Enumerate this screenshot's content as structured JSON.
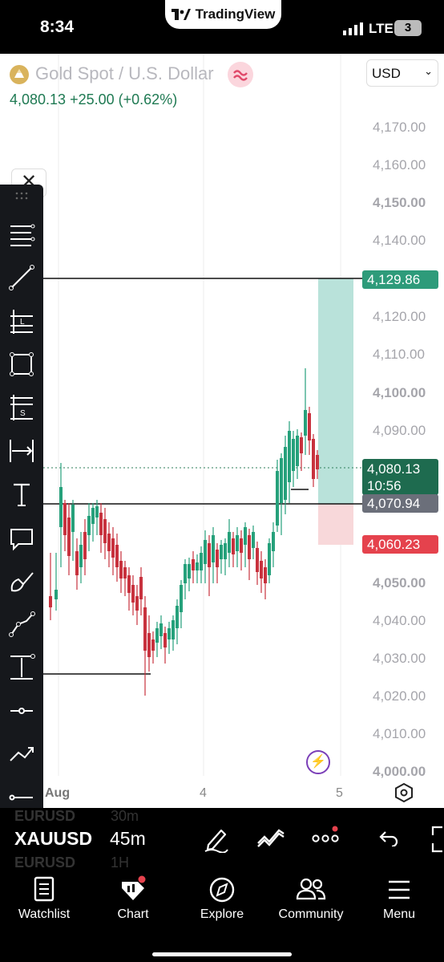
{
  "status_bar": {
    "time": "8:34",
    "app_name": "TradingView",
    "network": "LTE",
    "sim_badge": "3"
  },
  "chart": {
    "symbol_name": "Gold Spot / U.S. Dollar",
    "last_price": "4,080.13",
    "change": "+25.00 (+0.62%)",
    "currency": "USD",
    "price_labels": [
      {
        "text": "4,170.00",
        "bold": false
      },
      {
        "text": "4,160.00",
        "bold": false
      },
      {
        "text": "4,150.00",
        "bold": true
      },
      {
        "text": "4,140.00",
        "bold": false
      },
      {
        "text": "4,120.00",
        "bold": false
      },
      {
        "text": "4,110.00",
        "bold": false
      },
      {
        "text": "4,100.00",
        "bold": true
      },
      {
        "text": "4,090.00",
        "bold": false
      },
      {
        "text": "4,050.00",
        "bold": true
      },
      {
        "text": "4,040.00",
        "bold": false
      },
      {
        "text": "4,030.00",
        "bold": false
      },
      {
        "text": "4,020.00",
        "bold": false
      },
      {
        "text": "4,010.00",
        "bold": false
      },
      {
        "text": "4,000.00",
        "bold": true
      }
    ],
    "time_labels": [
      "Aug",
      "4",
      "5"
    ],
    "target_tag": "4,129.86",
    "current_tag_price": "4,080.13",
    "current_tag_countdown": "10:56",
    "entry_tag": "4,070.94",
    "stop_tag": "4,060.23",
    "colors": {
      "up": "#26a17b",
      "down": "#c8323e",
      "target_tag": "#2e9b7a",
      "current_tag": "#1e6b4f",
      "entry_tag": "#6b6f7a",
      "stop_tag": "#e5424d",
      "profit_zone": "#b9e2da",
      "loss_zone": "#f8d8da"
    }
  },
  "toolbar": {
    "tools": [
      "trend-lines-icon",
      "line-icon",
      "long-position-icon",
      "rectangle-icon",
      "short-label-icon",
      "measure-icon",
      "text-icon",
      "callout-icon",
      "brush-icon",
      "path-icon",
      "price-range-icon",
      "horizontal-line-icon",
      "arrow-path-icon",
      "ray-icon"
    ]
  },
  "symbol_bar": {
    "symbol": "XAUUSD",
    "interval": "45m",
    "ghost_above_symbol": "EURUSD",
    "ghost_above_interval": "30m",
    "ghost_below_symbol": "EURUSD",
    "ghost_below_interval": "1H"
  },
  "bottom_nav": {
    "items": [
      {
        "label": "Watchlist",
        "icon": "watchlist-icon"
      },
      {
        "label": "Chart",
        "icon": "chart-icon"
      },
      {
        "label": "Explore",
        "icon": "compass-icon"
      },
      {
        "label": "Community",
        "icon": "community-icon"
      },
      {
        "label": "Menu",
        "icon": "menu-icon"
      }
    ]
  }
}
